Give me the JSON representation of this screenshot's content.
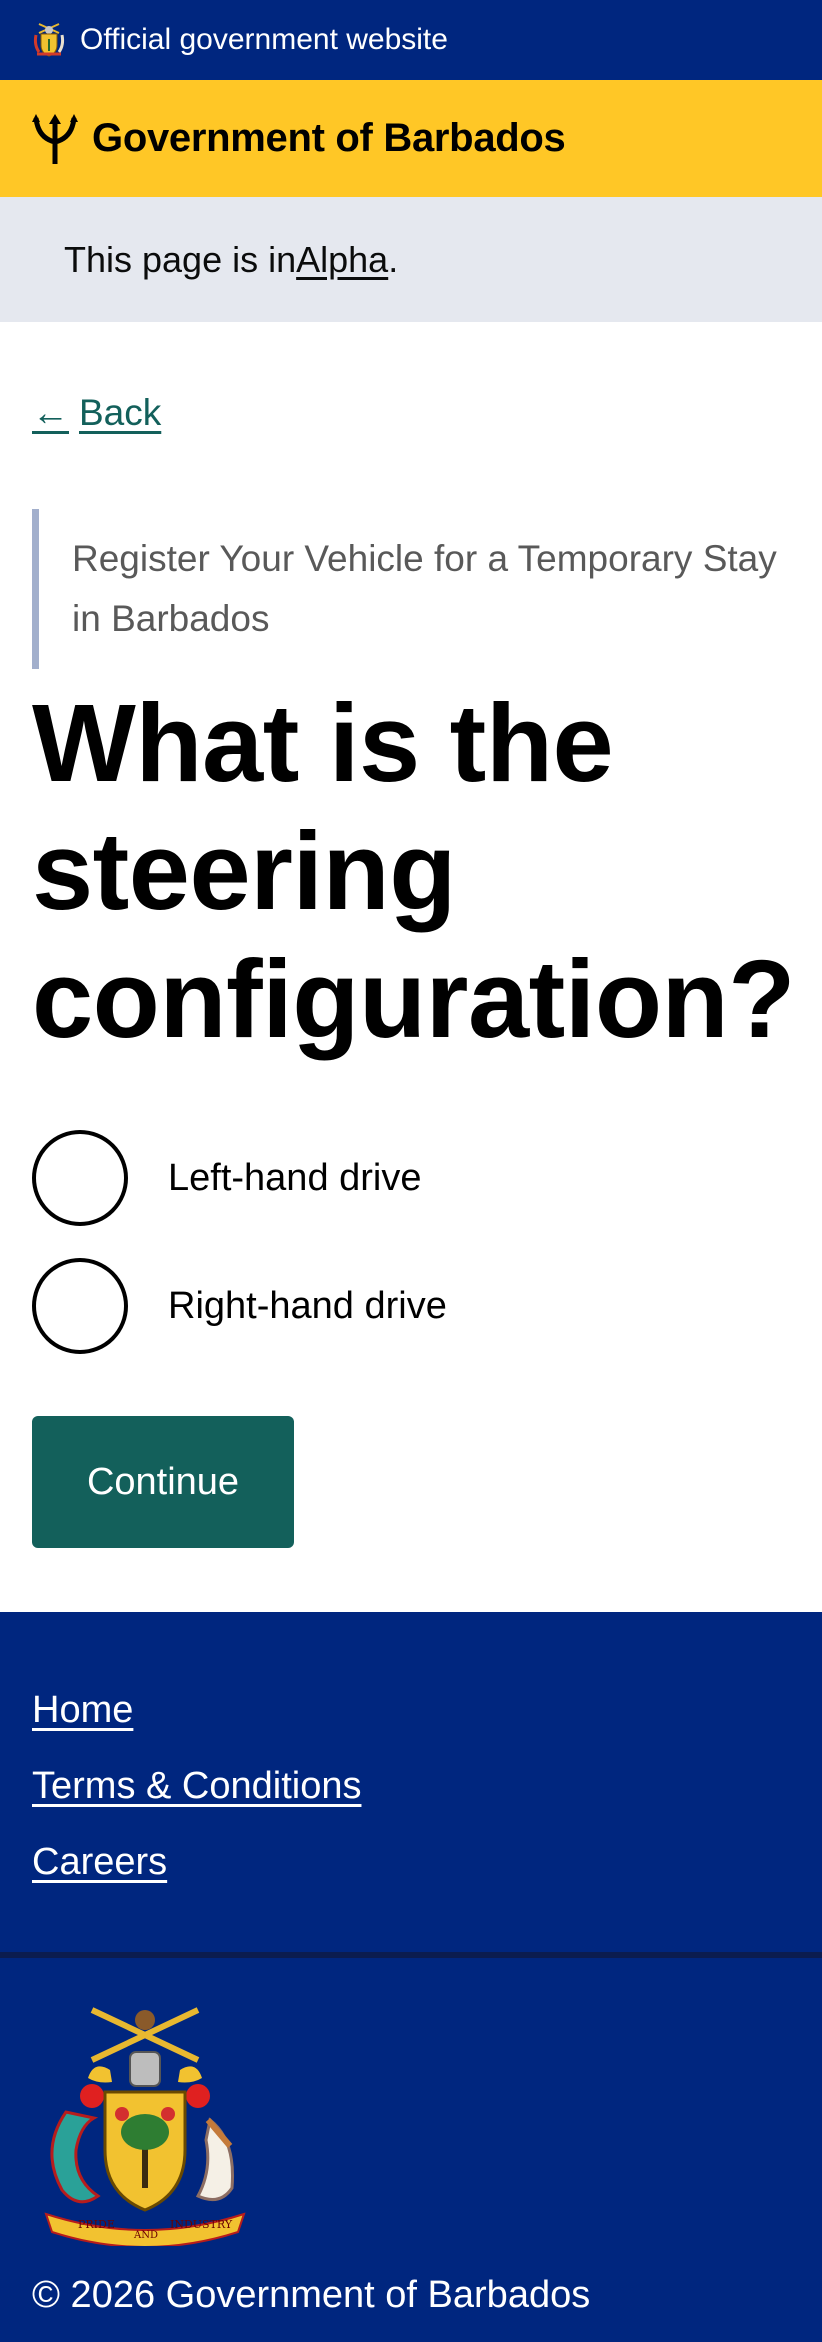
{
  "gov_banner": {
    "text": "Official government website",
    "icon": "barbados-crest-icon"
  },
  "brand": {
    "name": "Government of Barbados",
    "icon": "trident-icon"
  },
  "phase_banner": {
    "prefix": "This page is in ",
    "phase": "Alpha",
    "suffix": "."
  },
  "back_link": {
    "arrow": "←",
    "label": "Back"
  },
  "caption": "Register Your Vehicle for a Temporary Stay in Barbados",
  "heading": "What is the steering configuration?",
  "options": [
    {
      "label": "Left-hand drive",
      "selected": false
    },
    {
      "label": "Right-hand drive",
      "selected": false
    }
  ],
  "continue_label": "Continue",
  "footer": {
    "links": [
      "Home",
      "Terms & Conditions",
      "Careers"
    ],
    "motto": [
      "PRIDE",
      "AND",
      "INDUSTRY"
    ],
    "copyright": "© 2026 Government of Barbados"
  },
  "colors": {
    "navy": "#00267f",
    "gold": "#ffc726",
    "teal": "#13605b",
    "phase_bg": "#e5e8ef"
  }
}
